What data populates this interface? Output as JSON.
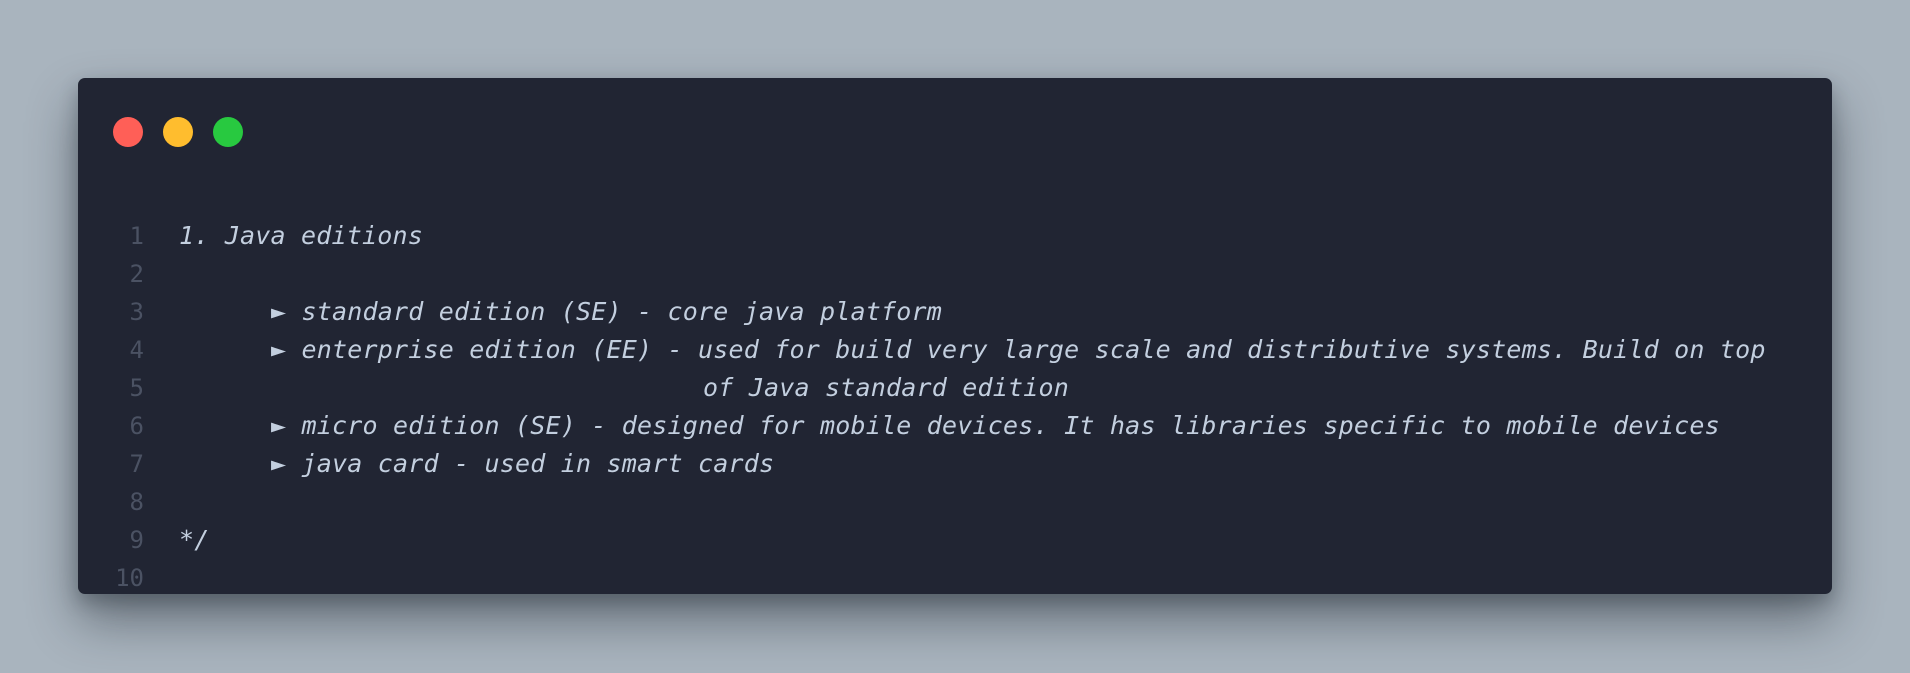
{
  "window": {
    "controls": [
      {
        "name": "close",
        "color": "#ff5f57"
      },
      {
        "name": "minimize",
        "color": "#ffbd2e"
      },
      {
        "name": "maximize",
        "color": "#28c940"
      }
    ]
  },
  "lines": [
    {
      "number": "1",
      "text": ""
    },
    {
      "number": "2",
      "text": "1. Java editions"
    },
    {
      "number": "3",
      "text": ""
    },
    {
      "number": "4",
      "text": "► standard edition (SE) - core java platform"
    },
    {
      "number": "5",
      "text": "► enterprise edition (EE) - used for build very large scale and distributive systems. Build on top"
    },
    {
      "number": "6",
      "text": "of Java standard edition"
    },
    {
      "number": "7",
      "text": "► micro edition (SE) - designed for mobile devices. It has libraries specific to mobile devices"
    },
    {
      "number": "8",
      "text": "► java card - used in smart cards"
    },
    {
      "number": "9",
      "text": ""
    },
    {
      "number": "10",
      "text": "*/"
    }
  ]
}
